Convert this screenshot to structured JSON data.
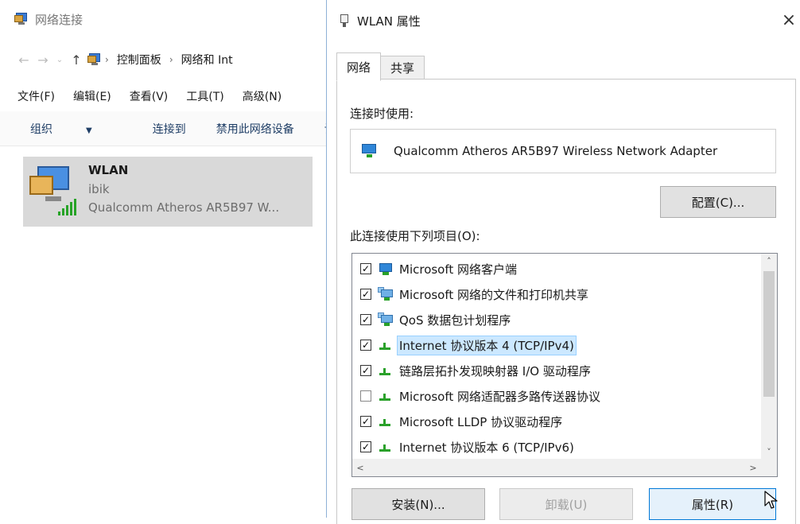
{
  "explorer": {
    "title": "网络连接",
    "nav": {
      "back": "←",
      "forward": "→",
      "recent": "⌄",
      "up": "↑",
      "breadcrumbs": [
        "控制面板",
        "网络和 Int"
      ]
    },
    "menu": [
      "文件(F)",
      "编辑(E)",
      "查看(V)",
      "工具(T)",
      "高级(N)"
    ],
    "toolbar": {
      "organize": "组织",
      "connect_to": "连接到",
      "disable": "禁用此网络设备",
      "more": "诊"
    },
    "connection": {
      "name": "WLAN",
      "ssid": "ibik",
      "adapter": "Qualcomm Atheros AR5B97 W..."
    }
  },
  "dialog": {
    "title": "WLAN 属性",
    "close": "×",
    "tabs": [
      "网络",
      "共享"
    ],
    "connect_using_label": "连接时使用:",
    "adapter_name": "Qualcomm Atheros AR5B97 Wireless Network Adapter",
    "configure_button": "配置(C)...",
    "items_label": "此连接使用下列项目(O):",
    "items": [
      {
        "label": "Microsoft 网络客户端",
        "checked": true,
        "icon": "network-client-icon",
        "selected": false
      },
      {
        "label": "Microsoft 网络的文件和打印机共享",
        "checked": true,
        "icon": "file-printer-sharing-icon",
        "selected": false
      },
      {
        "label": "QoS 数据包计划程序",
        "checked": true,
        "icon": "qos-scheduler-icon",
        "selected": false
      },
      {
        "label": "Internet 协议版本 4 (TCP/IPv4)",
        "checked": true,
        "icon": "protocol-icon",
        "selected": true
      },
      {
        "label": "链路层拓扑发现映射器 I/O 驱动程序",
        "checked": true,
        "icon": "protocol-icon",
        "selected": false
      },
      {
        "label": "Microsoft 网络适配器多路传送器协议",
        "checked": false,
        "icon": "protocol-icon",
        "selected": false
      },
      {
        "label": "Microsoft LLDP 协议驱动程序",
        "checked": true,
        "icon": "protocol-icon",
        "selected": false
      },
      {
        "label": "Internet 协议版本 6 (TCP/IPv6)",
        "checked": true,
        "icon": "protocol-icon",
        "selected": false
      }
    ],
    "scroll": {
      "up": "˄",
      "down": "˅",
      "left": "<",
      "right": ">"
    },
    "buttons": {
      "install": "安装(N)...",
      "uninstall": "卸载(U)",
      "properties": "属性(R)"
    }
  },
  "colors": {
    "accent": "#0078d7",
    "selection": "#cce8ff",
    "signal": "#27a327",
    "toolbar_text": "#1f3e66"
  }
}
